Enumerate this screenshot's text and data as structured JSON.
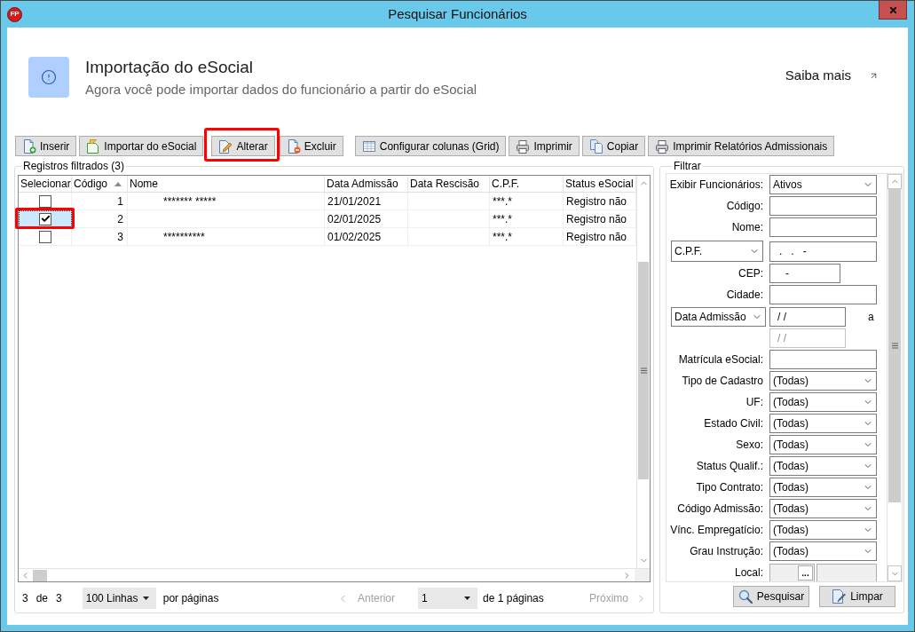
{
  "window": {
    "logo": "FP",
    "title": "Pesquisar Funcionários"
  },
  "banner": {
    "title": "Importação do eSocial",
    "subtitle": "Agora você pode importar dados do funcionário a partir do eSocial",
    "link": "Saiba mais"
  },
  "toolbar": {
    "groups": [
      {
        "buttons": [
          {
            "label": "Inserir",
            "highlighted": false
          },
          {
            "label": "Importar do eSocial",
            "highlighted": false
          },
          {
            "label": "Alterar",
            "highlighted": true
          },
          {
            "label": "Excluir",
            "highlighted": false
          }
        ]
      },
      {
        "buttons": [
          {
            "label": "Configurar colunas (Grid)",
            "highlighted": false
          },
          {
            "label": "Imprimir",
            "highlighted": false
          },
          {
            "label": "Copiar",
            "highlighted": false
          },
          {
            "label": "Imprimir Relatórios Admissionais",
            "highlighted": false
          }
        ]
      }
    ]
  },
  "records": {
    "title": "Registros filtrados (3)",
    "table": {
      "columns": [
        {
          "label": "Selecionar",
          "sorted": false
        },
        {
          "label": "Código",
          "sorted": true
        },
        {
          "label": "Nome",
          "sorted": false
        },
        {
          "label": "Data Admissão",
          "sorted": false
        },
        {
          "label": "Data Rescisão",
          "sorted": false
        },
        {
          "label": "C.P.F.",
          "sorted": false
        },
        {
          "label": "Status eSocial",
          "sorted": false
        }
      ],
      "rows": [
        {
          "checked": false,
          "selected": false,
          "highlighted": false,
          "codigo": "1",
          "nome": "******* *****",
          "data_admissao": "21/01/2021",
          "cpf": "***.*",
          "status_esocial": "Registro não"
        },
        {
          "checked": true,
          "selected": true,
          "highlighted": true,
          "codigo": "2",
          "data_admissao": "02/01/2025",
          "cpf": "***.*",
          "status_esocial": "Registro não"
        },
        {
          "checked": false,
          "selected": false,
          "highlighted": false,
          "codigo": "3",
          "nome": "**********",
          "data_admissao": "01/02/2025",
          "cpf": "***.*",
          "status_esocial": "Registro não"
        }
      ]
    },
    "pagination": {
      "shown": "3",
      "of": "de",
      "total": "3",
      "page_size": "100 Linhas",
      "page_size_suffix": "por páginas",
      "previous": {
        "label": "Anterior",
        "disabled": true
      },
      "page": "1",
      "page_count": "de 1 páginas",
      "next": {
        "label": "Próximo",
        "disabled": true
      }
    }
  },
  "filter": {
    "title": "Filtrar",
    "fields": [
      {
        "kind": "select",
        "label": "Exibir Funcionários:",
        "value": "Ativos"
      },
      {
        "kind": "text",
        "label": "Código:"
      },
      {
        "kind": "text",
        "label": "Nome:"
      },
      {
        "kind": "choice_text",
        "selector": "C.P.F.",
        "value": ".   .   -"
      },
      {
        "kind": "short_text",
        "label": "CEP:",
        "value": "-"
      },
      {
        "kind": "text",
        "label": "Cidade:"
      },
      {
        "kind": "date_range",
        "selector": "Data Admissão",
        "from": "/ /",
        "separator": "a",
        "to": "/ /",
        "to_disabled": true
      },
      {
        "kind": "text",
        "label": "Matrícula eSocial:"
      },
      {
        "kind": "select",
        "label": "Tipo de Cadastro",
        "value": "(Todas)"
      },
      {
        "kind": "select",
        "label": "UF:",
        "value": "(Todas)"
      },
      {
        "kind": "select",
        "label": "Estado Civil:",
        "value": "(Todas)"
      },
      {
        "kind": "select",
        "label": "Sexo:",
        "value": "(Todas)"
      },
      {
        "kind": "select",
        "label": "Status Qualif.:",
        "value": "(Todas)"
      },
      {
        "kind": "select",
        "label": "Tipo Contrato:",
        "value": "(Todas)"
      },
      {
        "kind": "select",
        "label": "Código Admissão:",
        "value": "(Todas)"
      },
      {
        "kind": "select",
        "label": "Vínc. Empregatício:",
        "value": "(Todas)"
      },
      {
        "kind": "select",
        "label": "Grau Instrução:",
        "value": "(Todas)"
      },
      {
        "kind": "lookup",
        "label": "Local:",
        "button": "..."
      }
    ],
    "buttons": [
      {
        "label": "Pesquisar"
      },
      {
        "label": "Limpar"
      }
    ]
  }
}
